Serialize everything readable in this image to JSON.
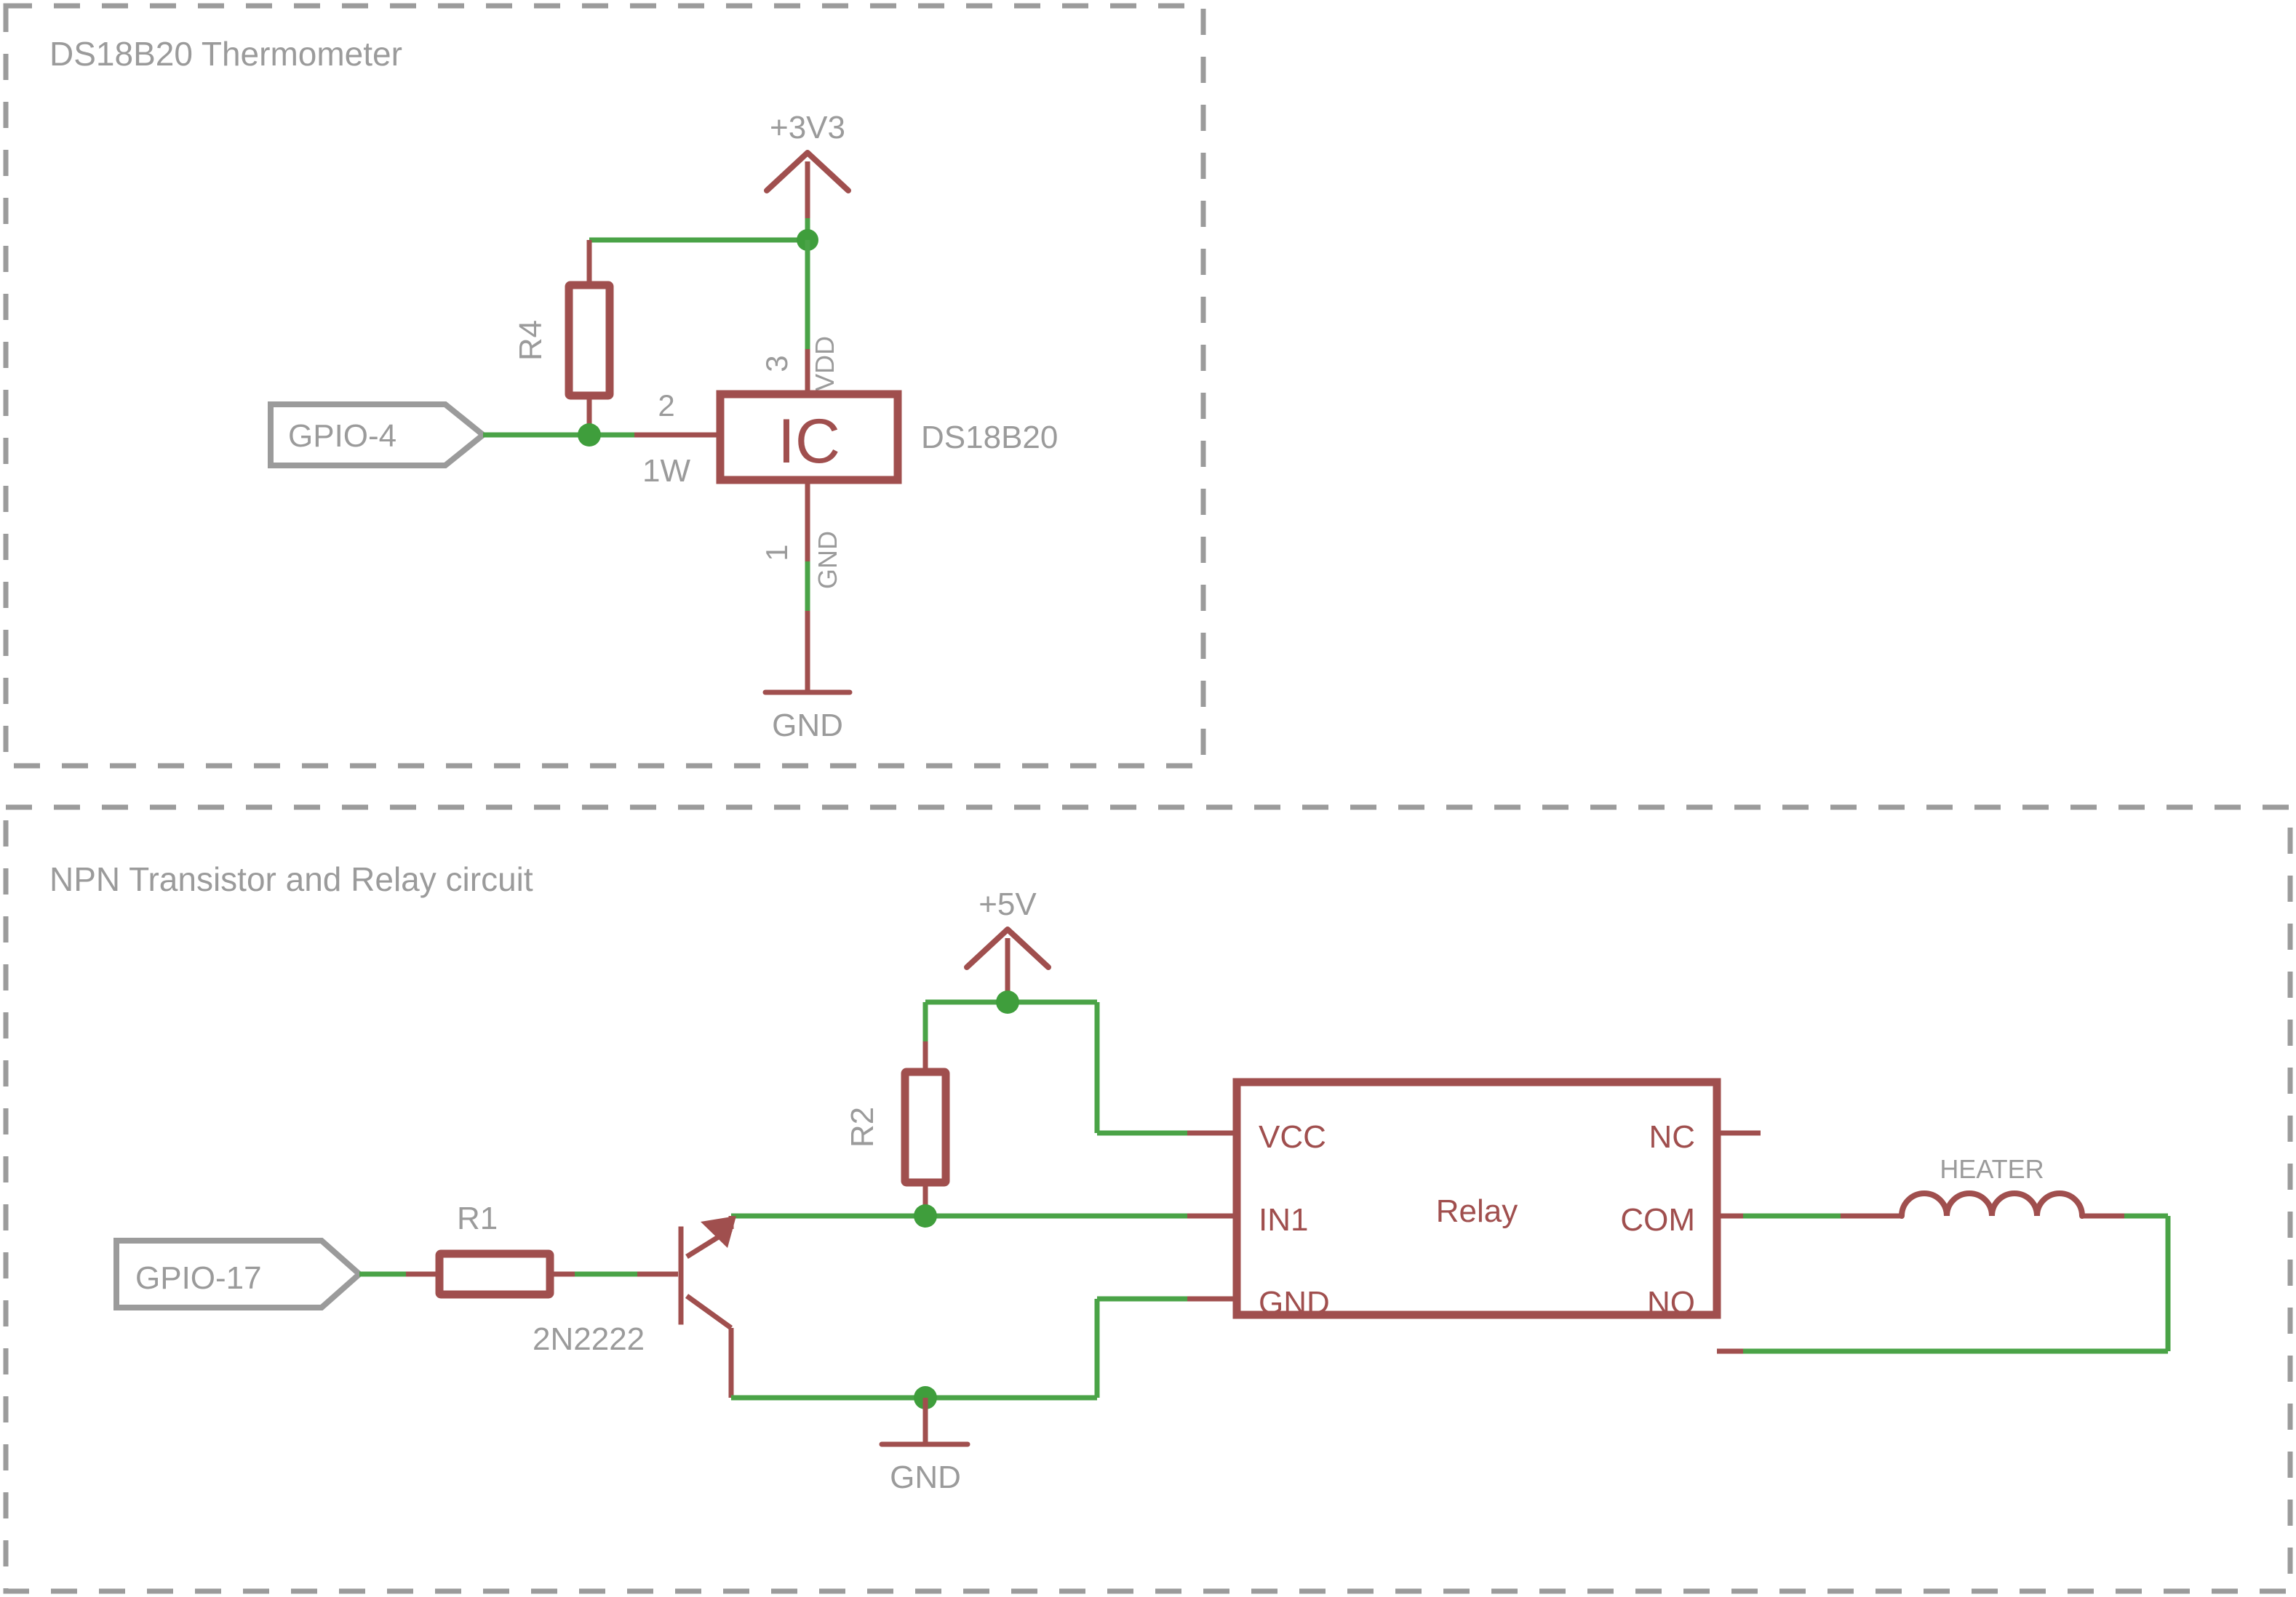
{
  "blocks": [
    {
      "title": "DS18B20 Thermometer"
    },
    {
      "title": "NPN Transistor and Relay circuit"
    }
  ],
  "thermometer": {
    "title": "DS18B20 Thermometer",
    "power_label": "+3V3",
    "gnd_label": "GND",
    "gpio_label": "GPIO-4",
    "resistor_ref": "R4",
    "ic_symbol_text": "IC",
    "ic_part_name": "DS18B20",
    "pins": [
      {
        "number": "3",
        "name": "VDD"
      },
      {
        "number": "2",
        "name": "1W"
      },
      {
        "number": "1",
        "name": "GND"
      }
    ]
  },
  "relay_circuit": {
    "title": "NPN Transistor and Relay circuit",
    "power_label": "+5V",
    "gnd_label": "GND",
    "gpio_label": "GPIO-17",
    "base_resistor_ref": "R1",
    "pullup_resistor_ref": "R2",
    "transistor_ref": "2N2222",
    "heater_ref": "HEATER",
    "relay_name": "Relay",
    "relay_pins_left": [
      "VCC",
      "IN1",
      "GND"
    ],
    "relay_pins_right": [
      "NC",
      "COM",
      "NO"
    ]
  },
  "colors": {
    "component_red": "#a04f4e",
    "net_green": "#4aa347",
    "junction_green": "#3f9e3c",
    "annotation_gray": "#9b9b9b",
    "background": "#ffffff"
  }
}
